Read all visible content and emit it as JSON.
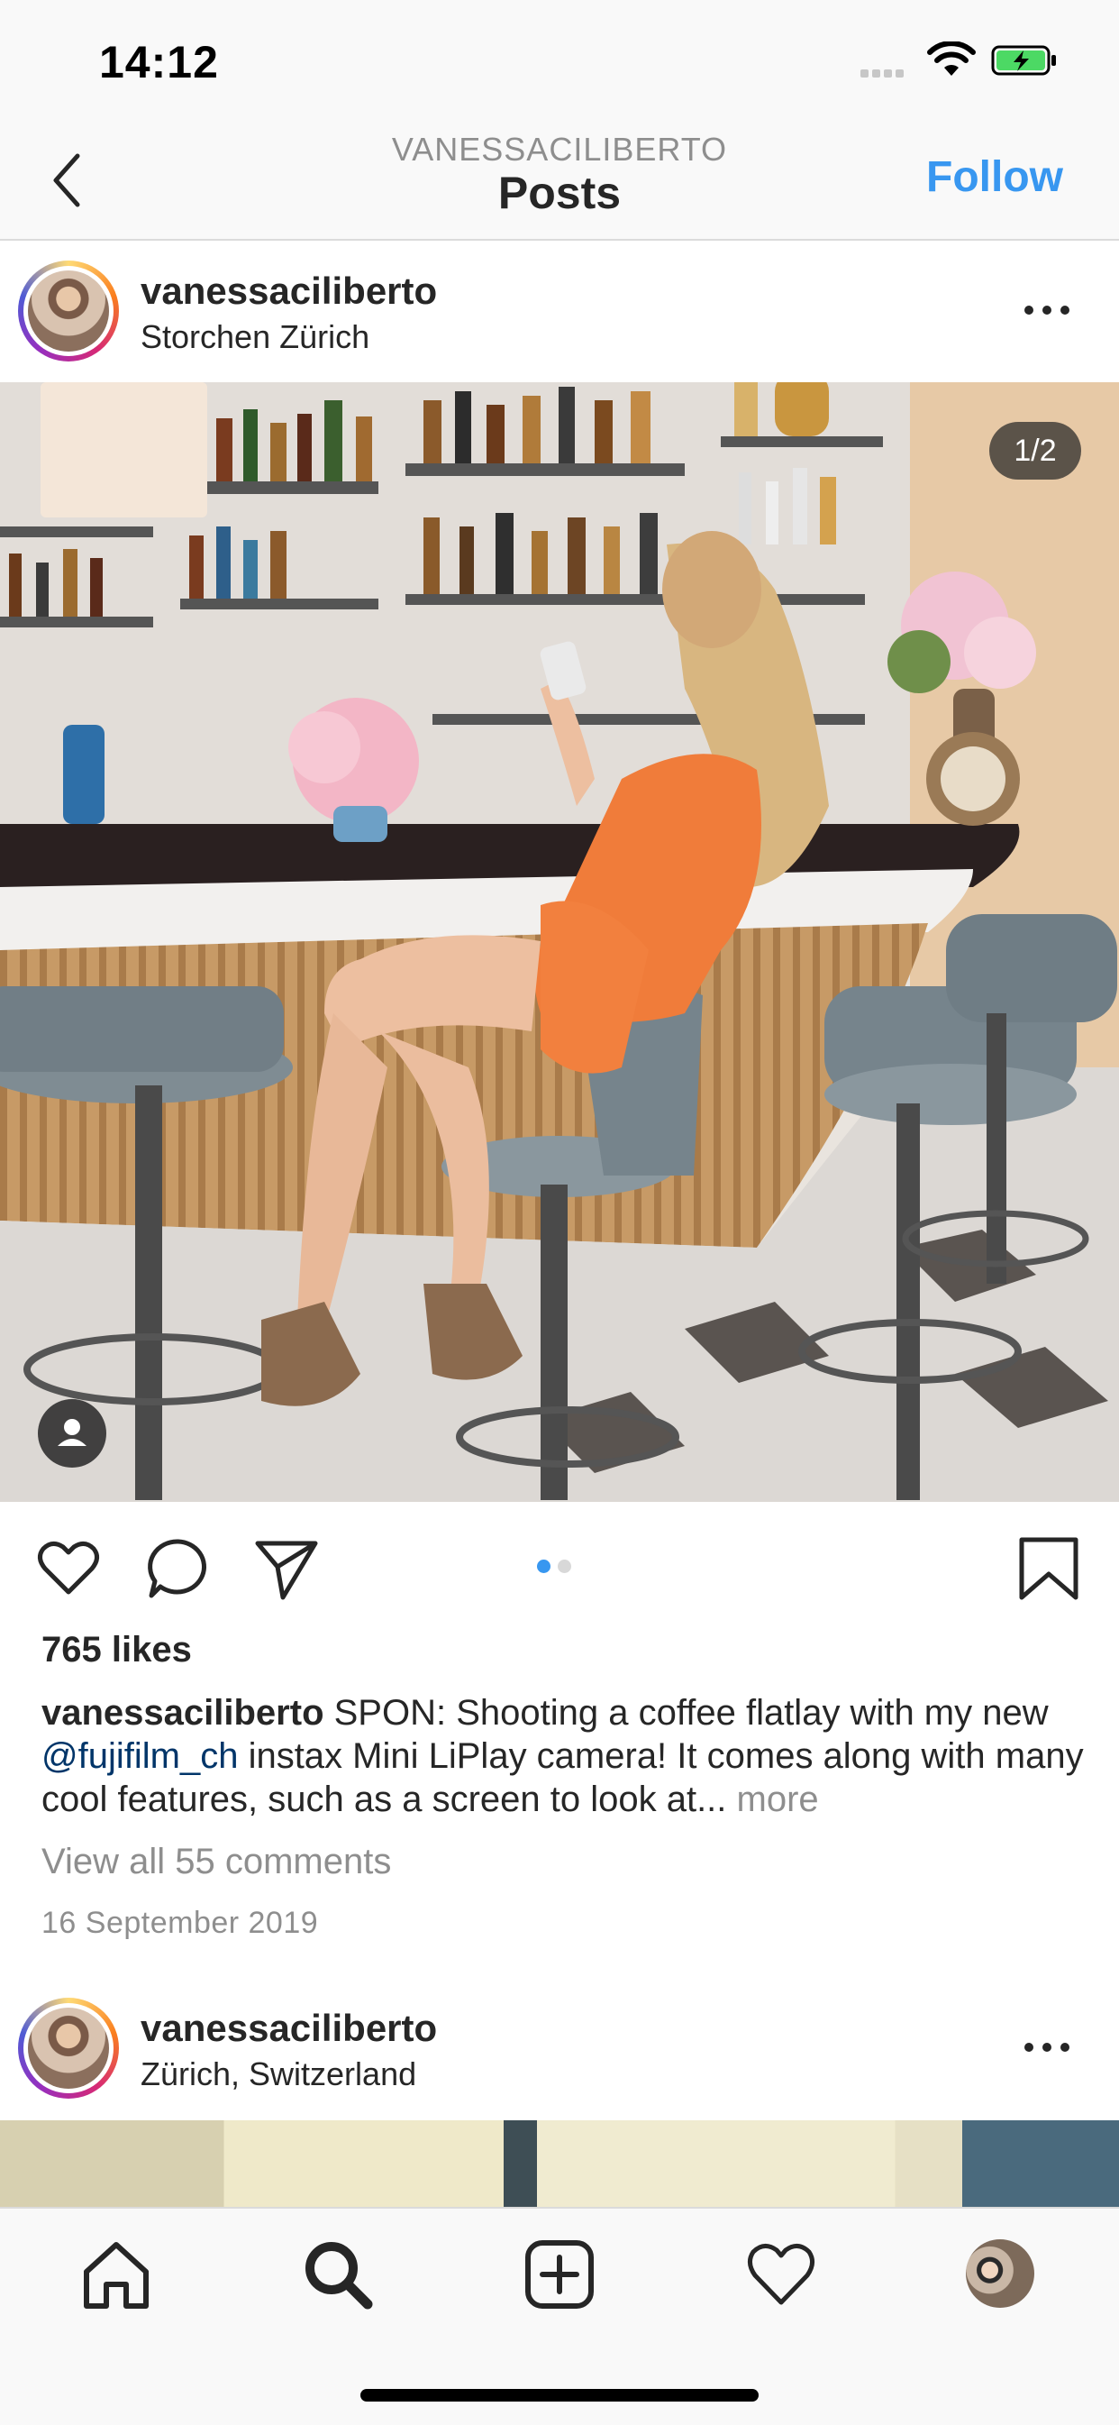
{
  "status_bar": {
    "time": "14:12"
  },
  "header": {
    "username": "VANESSACILIBERTO",
    "title": "Posts",
    "follow_label": "Follow"
  },
  "post1": {
    "username": "vanessaciliberto",
    "location": "Storchen Zürich",
    "page_counter": "1/2",
    "likes": "765 likes",
    "caption": {
      "username": "vanessaciliberto",
      "text_before": "SPON: Shooting a coffee flatlay with my new",
      "mention": "@fujifilm_ch",
      "text_after": "instax Mini LiPlay camera! It comes along with many cool features, such as a screen to look at...",
      "more": "more"
    },
    "view_comments": "View all 55 comments",
    "date": "16 September 2019",
    "carousel_active_index": 0,
    "carousel_count": 2
  },
  "post2": {
    "username": "vanessaciliberto",
    "location": "Zürich, Switzerland"
  },
  "colors": {
    "accent": "#3897f0",
    "mention": "#003569",
    "muted": "#8e8e8e",
    "text": "#262626"
  },
  "icons": [
    "back-chevron-icon",
    "wifi-icon",
    "battery-charging-icon",
    "more-options-icon",
    "heart-icon",
    "comment-icon",
    "share-icon",
    "bookmark-icon",
    "user-tag-icon",
    "home-icon",
    "search-icon",
    "add-post-icon",
    "activity-heart-icon",
    "profile-avatar-icon"
  ]
}
